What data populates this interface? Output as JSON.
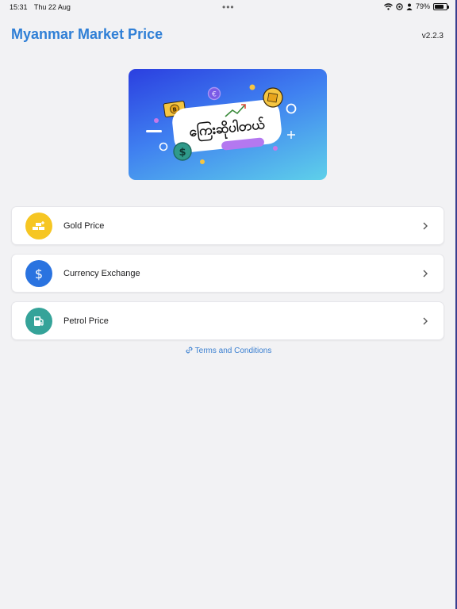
{
  "status_bar": {
    "time": "15:31",
    "date": "Thu 22 Aug",
    "battery": "79%",
    "battery_level": 0.79
  },
  "header": {
    "title": "Myanmar Market Price",
    "version": "v2.2.3"
  },
  "banner": {
    "text": "ကြေးဆိုပါတယ်"
  },
  "menu": [
    {
      "label": "Gold Price",
      "icon": "gold-bars-icon",
      "color": "#f6c623"
    },
    {
      "label": "Currency Exchange",
      "icon": "dollar-icon",
      "color": "#2a73e0"
    },
    {
      "label": "Petrol Price",
      "icon": "fuel-pump-icon",
      "color": "#35a399"
    }
  ],
  "footer": {
    "terms_label": "Terms and Conditions"
  }
}
